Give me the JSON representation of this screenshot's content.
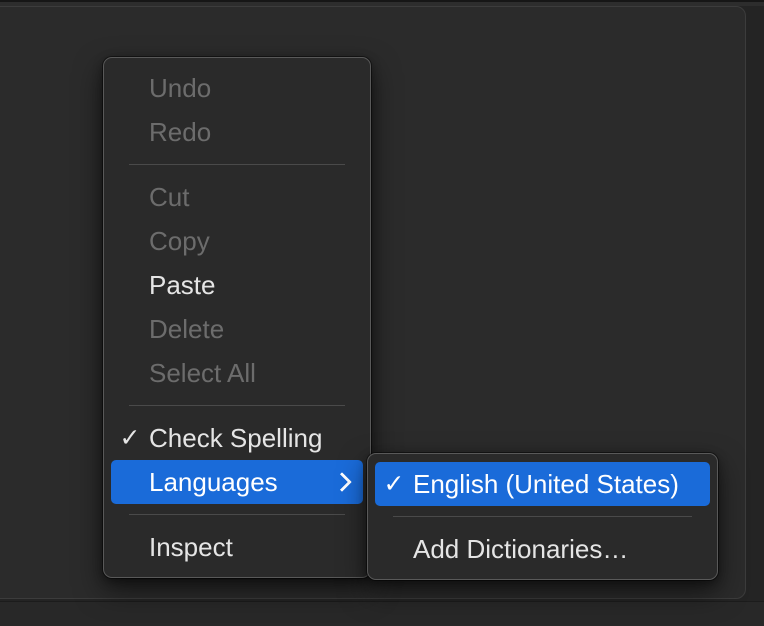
{
  "colors": {
    "menu_background": "#2a2a2a",
    "menu_border": "#595959",
    "highlight_blue": "#1a6bd9",
    "enabled_text": "#e5e5e5",
    "disabled_text": "#6c6c6c",
    "highlighted_text": "#ffffff",
    "separator": "#4a4a4a",
    "page_background": "#2b2b2b"
  },
  "icons": {
    "checkmark": "✓",
    "submenu_chevron": "chevron-right"
  },
  "context_menu": {
    "items": [
      {
        "label": "Undo",
        "state": "disabled"
      },
      {
        "label": "Redo",
        "state": "disabled"
      },
      {
        "type": "separator"
      },
      {
        "label": "Cut",
        "state": "disabled"
      },
      {
        "label": "Copy",
        "state": "disabled"
      },
      {
        "label": "Paste",
        "state": "enabled"
      },
      {
        "label": "Delete",
        "state": "disabled"
      },
      {
        "label": "Select All",
        "state": "disabled"
      },
      {
        "type": "separator"
      },
      {
        "label": "Check Spelling",
        "state": "enabled",
        "checked": true
      },
      {
        "label": "Languages",
        "state": "highlighted",
        "has_submenu": true
      },
      {
        "type": "separator"
      },
      {
        "label": "Inspect",
        "state": "enabled"
      }
    ]
  },
  "languages_submenu": {
    "items": [
      {
        "label": "English (United States)",
        "state": "highlighted",
        "checked": true
      },
      {
        "type": "separator"
      },
      {
        "label": "Add Dictionaries…",
        "state": "enabled"
      }
    ]
  }
}
